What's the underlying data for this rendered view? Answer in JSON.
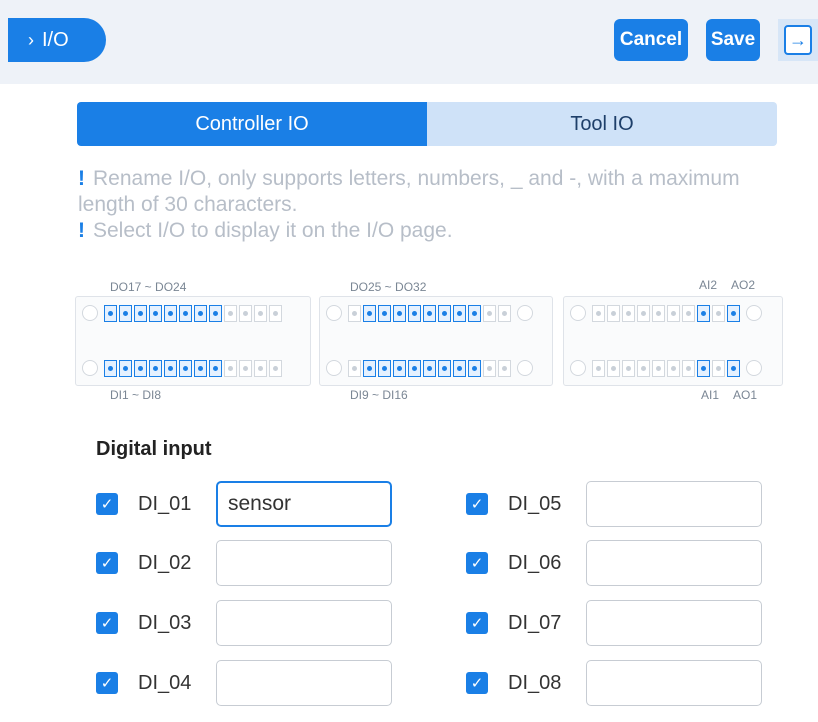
{
  "header": {
    "breadcrumb": "I/O",
    "cancel_label": "Cancel",
    "save_label": "Save"
  },
  "tabs": [
    {
      "label": "Controller IO",
      "active": true
    },
    {
      "label": "Tool IO",
      "active": false
    }
  ],
  "notes": [
    "Rename I/O, only supports letters, numbers, _ and -, with a maximum length of 30 characters.",
    "Select I/O to display it on the I/O page."
  ],
  "diagram": {
    "labels": {
      "do17_24": "DO17 ~ DO24",
      "do25_32": "DO25 ~ DO32",
      "ai2": "AI2",
      "ao2": "AO2",
      "di1_8": "DI1 ~ DI8",
      "di9_16": "DI9 ~ DI16",
      "ai1": "AI1",
      "ao1": "AO1"
    }
  },
  "digital_input": {
    "title": "Digital input",
    "items": [
      {
        "label": "DI_01",
        "value": "sensor",
        "checked": true
      },
      {
        "label": "DI_02",
        "value": "",
        "checked": true
      },
      {
        "label": "DI_03",
        "value": "",
        "checked": true
      },
      {
        "label": "DI_04",
        "value": "",
        "checked": true
      },
      {
        "label": "DI_05",
        "value": "",
        "checked": true
      },
      {
        "label": "DI_06",
        "value": "",
        "checked": true
      },
      {
        "label": "DI_07",
        "value": "",
        "checked": true
      },
      {
        "label": "DI_08",
        "value": "",
        "checked": true
      }
    ]
  },
  "colors": {
    "accent": "#1a7fe6",
    "tab_inactive": "#cfe2f8",
    "note_text": "#b7bec8"
  }
}
